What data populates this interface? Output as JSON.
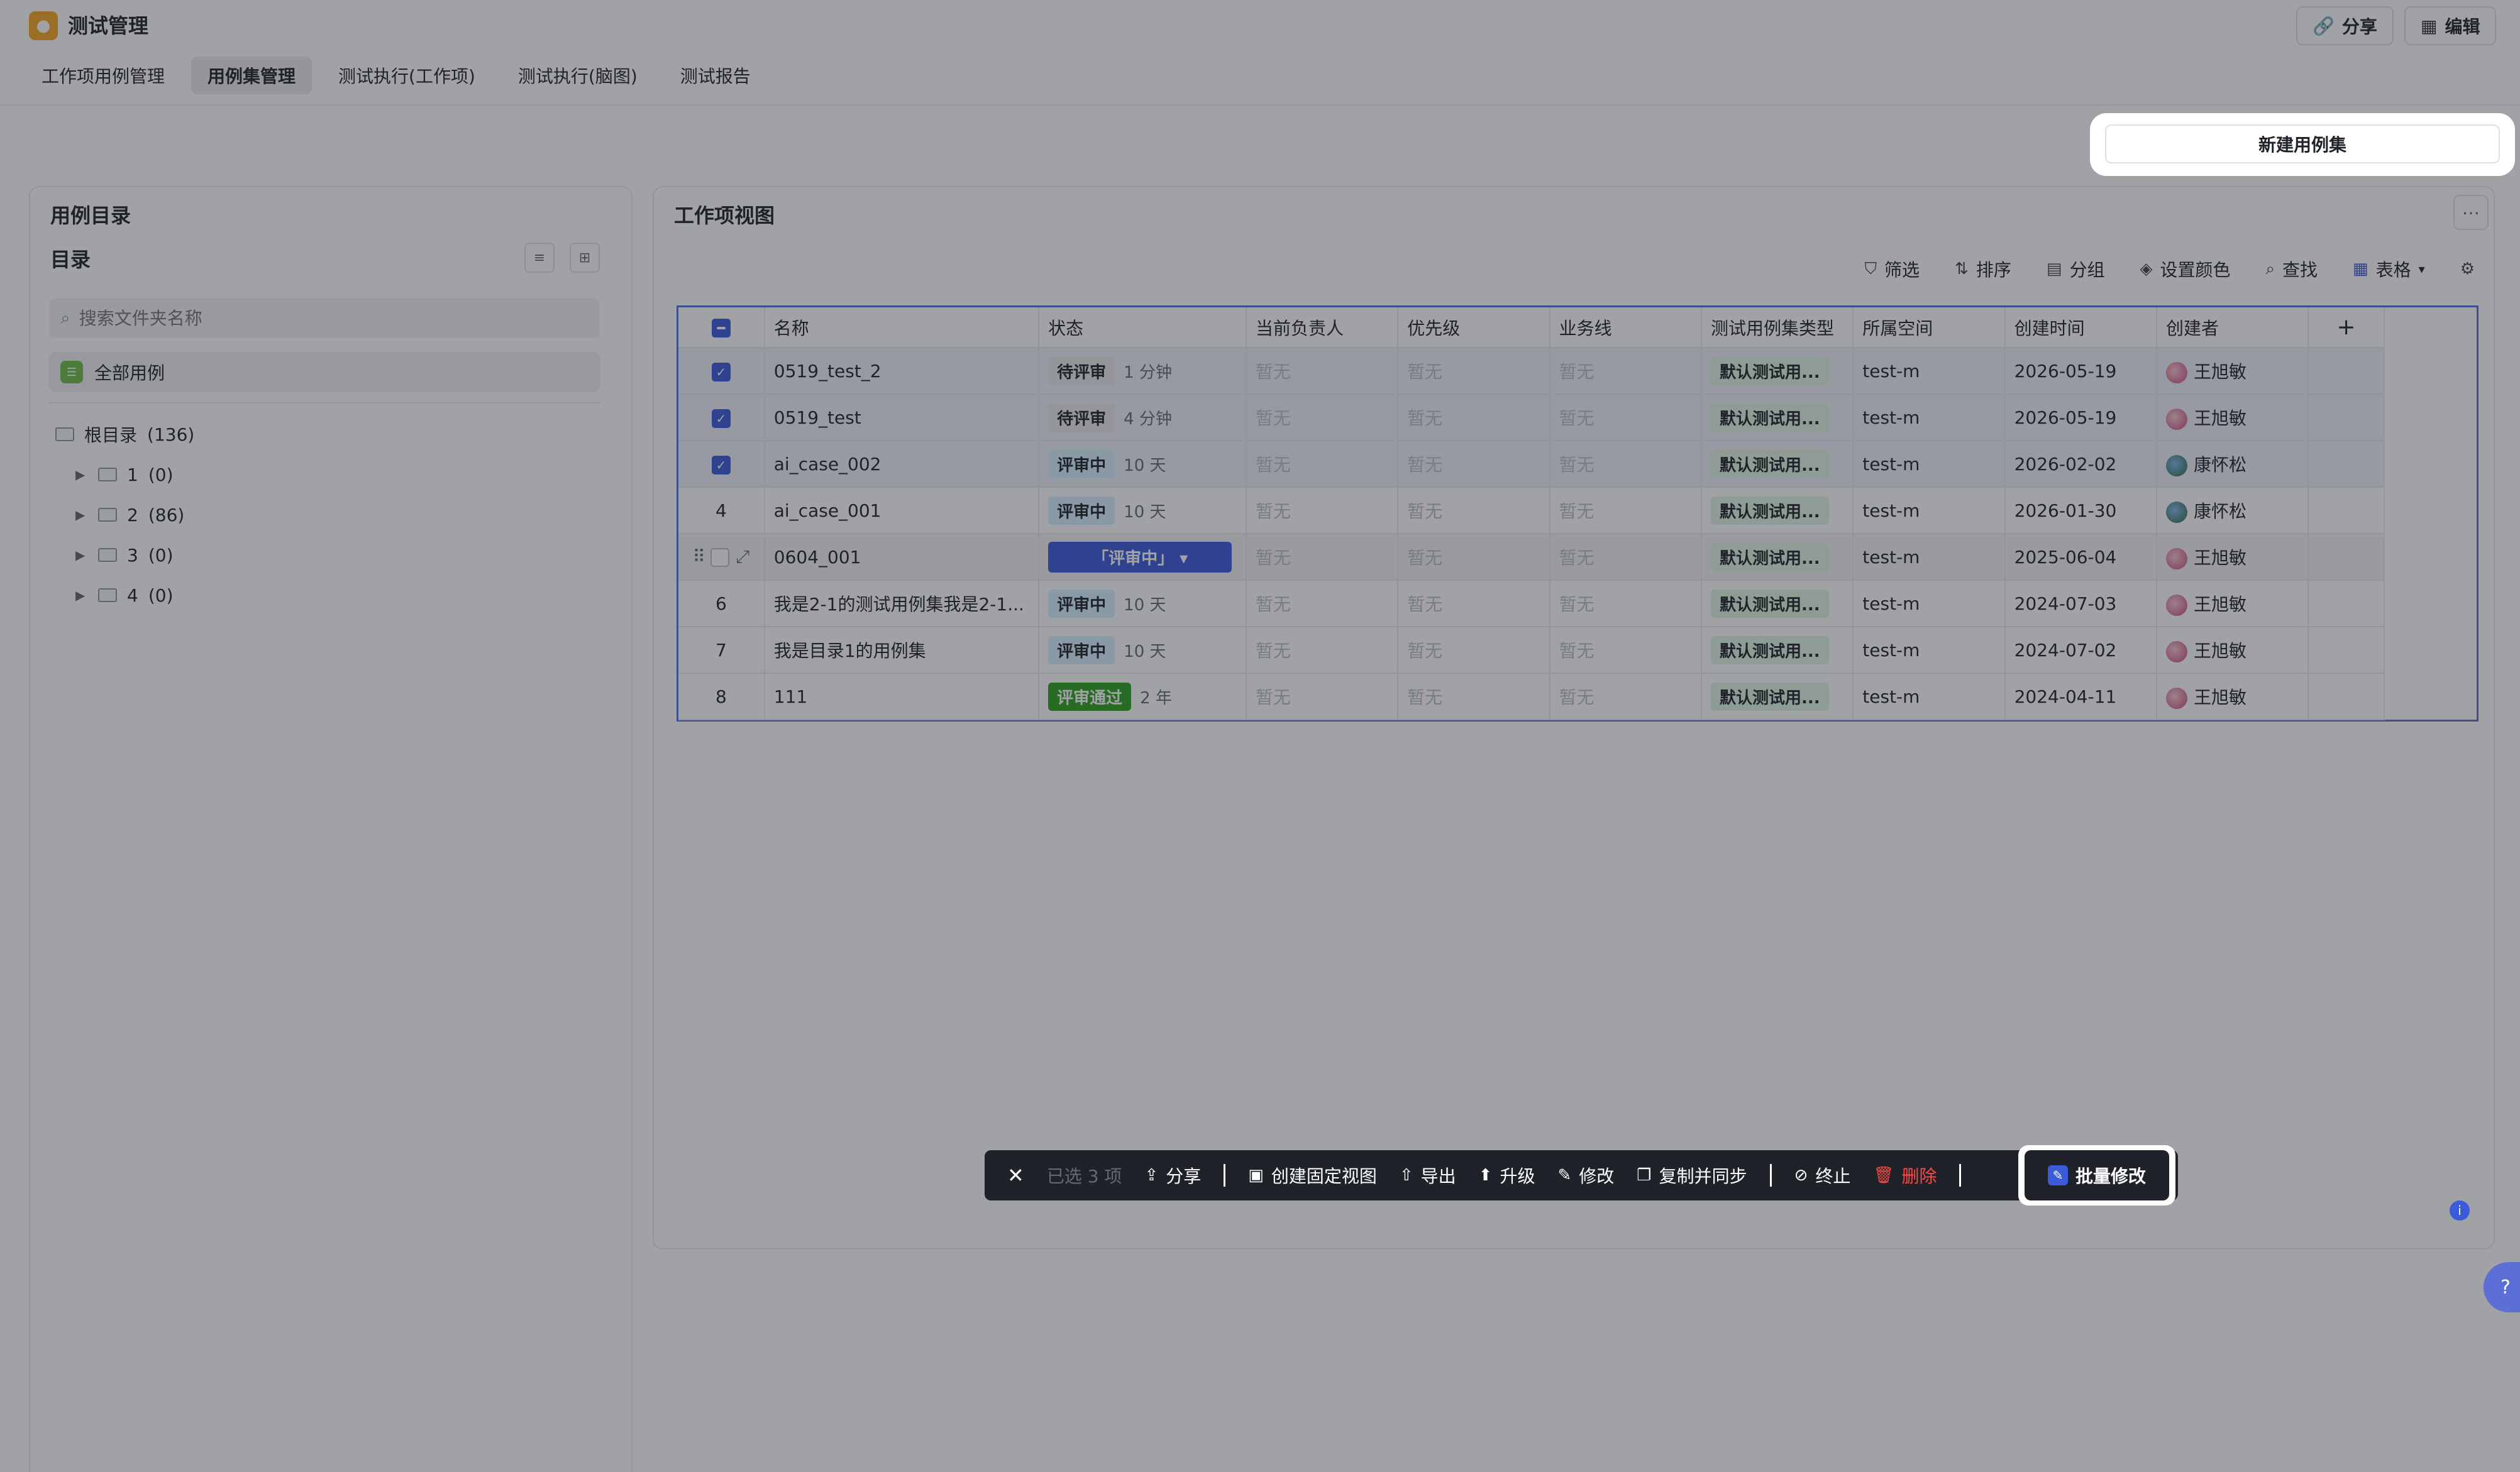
{
  "app": {
    "title": "测试管理"
  },
  "header_buttons": {
    "share": "分享",
    "edit": "编辑"
  },
  "tabs": [
    {
      "label": "工作项用例管理"
    },
    {
      "label": "用例集管理"
    },
    {
      "label": "测试执行(工作项)"
    },
    {
      "label": "测试执行(脑图)"
    },
    {
      "label": "测试报告"
    }
  ],
  "new_button": "新建用例集",
  "left_panel": {
    "title": "用例目录",
    "subtitle": "目录",
    "search_placeholder": "搜索文件夹名称",
    "all_cases": "全部用例",
    "tree": [
      {
        "label": "根目录",
        "count": "(136)"
      },
      {
        "label": "1",
        "count": "(0)"
      },
      {
        "label": "2",
        "count": "(86)"
      },
      {
        "label": "3",
        "count": "(0)"
      },
      {
        "label": "4",
        "count": "(0)"
      }
    ]
  },
  "right_panel": {
    "title": "工作项视图",
    "toolbar": {
      "filter": "筛选",
      "sort": "排序",
      "group": "分组",
      "color": "设置颜色",
      "find": "查找",
      "view": "表格"
    }
  },
  "table": {
    "columns": [
      "名称",
      "状态",
      "当前负责人",
      "优先级",
      "业务线",
      "测试用例集类型",
      "所属空间",
      "创建时间",
      "创建者"
    ],
    "rows": [
      {
        "idx": "",
        "name": "0519_test_2",
        "status": "待评审",
        "status_kind": "wait",
        "duration": "1 分钟",
        "owner": "暂无",
        "priority": "暂无",
        "bizline": "暂无",
        "type": "默认测试用...",
        "space": "test-m",
        "created": "2026-05-19",
        "creator": "王旭敏",
        "avatar": "pink",
        "selected": true
      },
      {
        "idx": "",
        "name": "0519_test",
        "status": "待评审",
        "status_kind": "wait",
        "duration": "4 分钟",
        "owner": "暂无",
        "priority": "暂无",
        "bizline": "暂无",
        "type": "默认测试用...",
        "space": "test-m",
        "created": "2026-05-19",
        "creator": "王旭敏",
        "avatar": "pink",
        "selected": true
      },
      {
        "idx": "",
        "name": "ai_case_002",
        "status": "评审中",
        "status_kind": "rev",
        "duration": "10 天",
        "owner": "暂无",
        "priority": "暂无",
        "bizline": "暂无",
        "type": "默认测试用...",
        "space": "test-m",
        "created": "2026-02-02",
        "creator": "康怀松",
        "avatar": "earth",
        "selected": true
      },
      {
        "idx": "4",
        "name": "ai_case_001",
        "status": "评审中",
        "status_kind": "rev",
        "duration": "10 天",
        "owner": "暂无",
        "priority": "暂无",
        "bizline": "暂无",
        "type": "默认测试用...",
        "space": "test-m",
        "created": "2026-01-30",
        "creator": "康怀松",
        "avatar": "earth",
        "selected": false
      },
      {
        "idx": "",
        "name": "0604_001",
        "status": "「评审中」",
        "status_kind": "edit",
        "duration": "",
        "owner": "暂无",
        "priority": "暂无",
        "bizline": "暂无",
        "type": "默认测试用...",
        "space": "test-m",
        "created": "2025-06-04",
        "creator": "王旭敏",
        "avatar": "pink",
        "selected": false
      },
      {
        "idx": "6",
        "name": "我是2-1的测试用例集我是2-1...",
        "status": "评审中",
        "status_kind": "rev",
        "duration": "10 天",
        "owner": "暂无",
        "priority": "暂无",
        "bizline": "暂无",
        "type": "默认测试用...",
        "space": "test-m",
        "created": "2024-07-03",
        "creator": "王旭敏",
        "avatar": "pink",
        "selected": false
      },
      {
        "idx": "7",
        "name": "我是目录1的用例集",
        "status": "评审中",
        "status_kind": "rev",
        "duration": "10 天",
        "owner": "暂无",
        "priority": "暂无",
        "bizline": "暂无",
        "type": "默认测试用...",
        "space": "test-m",
        "created": "2024-07-02",
        "creator": "王旭敏",
        "avatar": "pink",
        "selected": false
      },
      {
        "idx": "8",
        "name": "111",
        "status": "评审通过",
        "status_kind": "pass",
        "duration": "2 年",
        "owner": "暂无",
        "priority": "暂无",
        "bizline": "暂无",
        "type": "默认测试用...",
        "space": "test-m",
        "created": "2024-04-11",
        "creator": "王旭敏",
        "avatar": "pink",
        "selected": false
      }
    ]
  },
  "action_bar": {
    "selected": "已选 3 项",
    "share": "分享",
    "fixed_view": "创建固定视图",
    "export": "导出",
    "upgrade": "升级",
    "modify": "修改",
    "copy_sync": "复制并同步",
    "terminate": "终止",
    "delete": "删除",
    "batch_modify": "批量修改"
  }
}
